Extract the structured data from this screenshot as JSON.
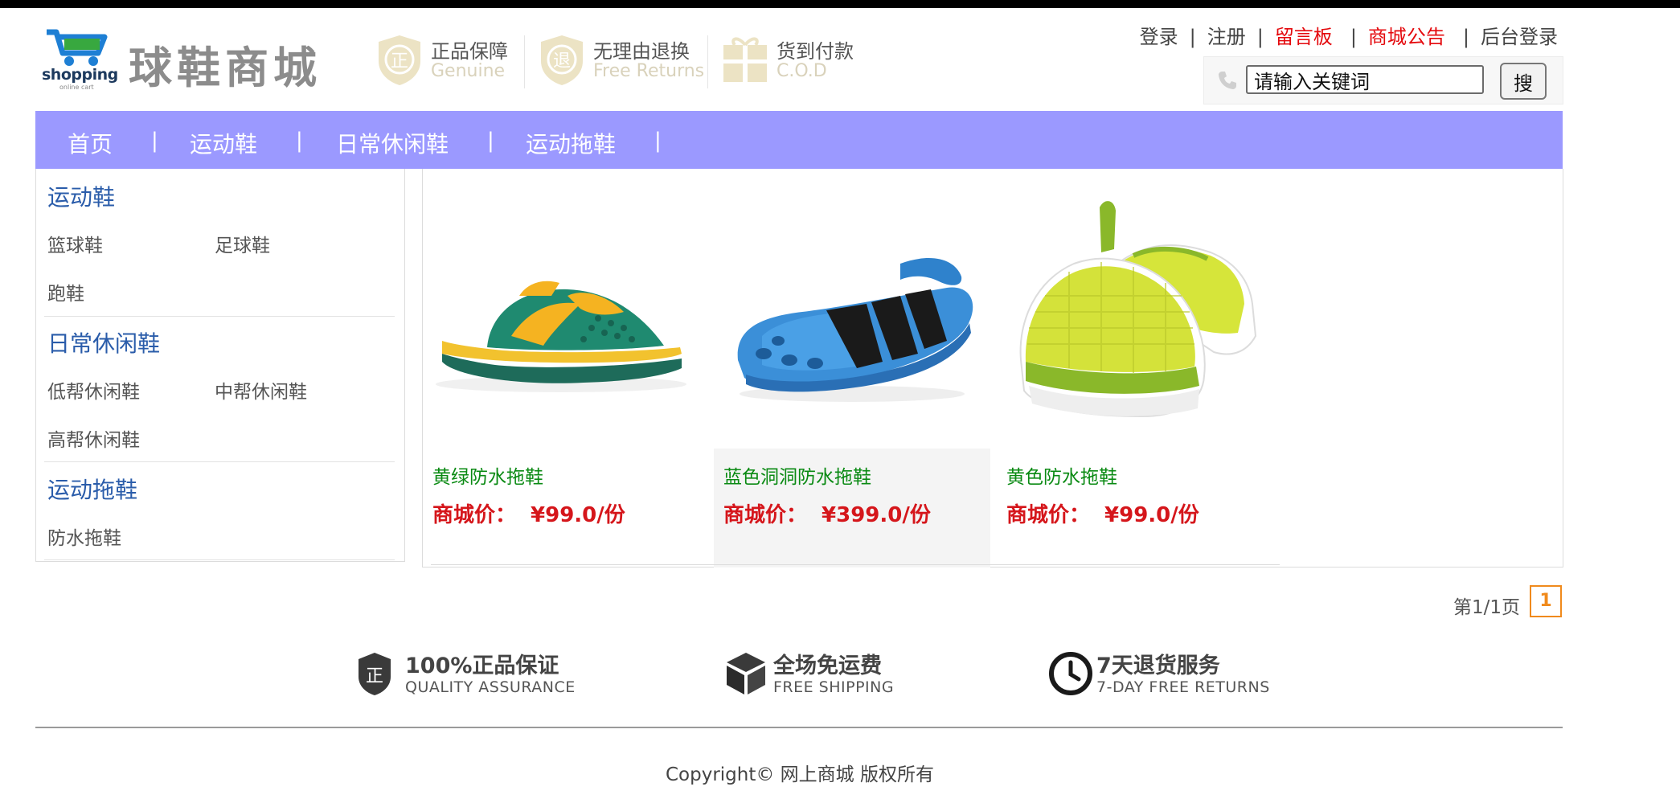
{
  "header": {
    "logo_text": "shopping",
    "logo_subtext": "online cart",
    "site_name": "球鞋商城",
    "promises": [
      {
        "title": "正品保障",
        "subtitle": "Genuine",
        "icon": "shield-zheng-icon"
      },
      {
        "title": "无理由退换",
        "subtitle": "Free Returns",
        "icon": "shield-tui-icon"
      },
      {
        "title": "货到付款",
        "subtitle": "C.O.D",
        "icon": "gift-box-icon"
      }
    ],
    "links": [
      {
        "label": "登录",
        "highlight": false
      },
      {
        "label": "注册",
        "highlight": false
      },
      {
        "label": "留言板",
        "highlight": true
      },
      {
        "label": "商城公告",
        "highlight": true
      },
      {
        "label": "后台登录",
        "highlight": false
      }
    ],
    "search": {
      "value": "请输入关键词",
      "button": "搜"
    }
  },
  "nav": {
    "items": [
      "首页",
      "运动鞋",
      "日常休闲鞋",
      "运动拖鞋"
    ],
    "separator": "|"
  },
  "sidebar": {
    "categories": [
      {
        "title": "运动鞋",
        "links": [
          "篮球鞋",
          "足球鞋",
          "跑鞋"
        ]
      },
      {
        "title": "日常休闲鞋",
        "links": [
          "低帮休闲鞋",
          "中帮休闲鞋",
          "高帮休闲鞋"
        ]
      },
      {
        "title": "运动拖鞋",
        "links": [
          "防水拖鞋"
        ]
      }
    ]
  },
  "products": [
    {
      "name": "黄绿防水拖鞋",
      "price_label": "商城价：",
      "price": "¥99.0/份"
    },
    {
      "name": "蓝色洞洞防水拖鞋",
      "price_label": "商城价：",
      "price": "¥399.0/份"
    },
    {
      "name": "黄色防水拖鞋",
      "price_label": "商城价：",
      "price": "¥99.0/份"
    }
  ],
  "pagination": {
    "info": "第1/1页",
    "current": "1"
  },
  "services": [
    {
      "title": "100%正品保证",
      "subtitle": "QUALITY ASSURANCE",
      "icon": "quality-shield-icon"
    },
    {
      "title": "全场免运费",
      "subtitle": "FREE SHIPPING",
      "icon": "package-box-icon"
    },
    {
      "title": "7天退货服务",
      "subtitle": "7-DAY FREE RETURNS",
      "icon": "clock-icon"
    }
  ],
  "footer": {
    "copyright": "Copyright© 网上商城 版权所有"
  },
  "colors": {
    "nav_bg": "#9b99ff",
    "price": "#d5161b",
    "product_name": "#0a8a13",
    "category_title": "#2a5caa",
    "link_highlight": "#e4090d",
    "pager_accent": "#f08a1c"
  }
}
